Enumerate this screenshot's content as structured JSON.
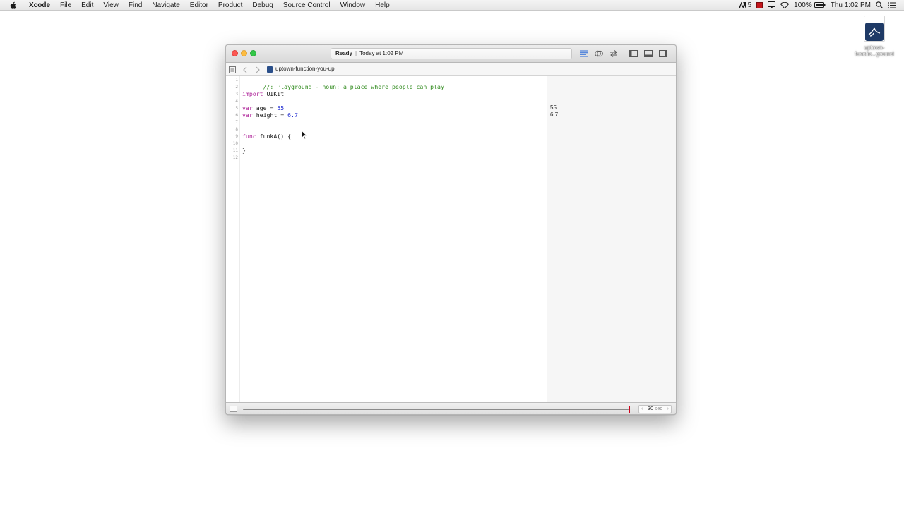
{
  "menubar": {
    "app_name": "Xcode",
    "items": [
      "File",
      "Edit",
      "View",
      "Find",
      "Navigate",
      "Editor",
      "Product",
      "Debug",
      "Source Control",
      "Window",
      "Help"
    ],
    "status": {
      "notifications_count": "5",
      "battery": "100%",
      "clock": "Thu 1:02 PM"
    }
  },
  "desktop": {
    "file_label": "uptown-functio...ground"
  },
  "window": {
    "activity_status": "Ready",
    "activity_separator": "|",
    "activity_time": "Today at 1:02 PM",
    "jumpbar_file": "uptown-function-you-up"
  },
  "editor": {
    "line_numbers": [
      "1",
      "2",
      "3",
      "4",
      "5",
      "6",
      "7",
      "8",
      "9",
      "10",
      "11",
      "12"
    ],
    "lines": {
      "l1_comment": "//: Playground - noun: a place where people can play",
      "l3_keyword": "import",
      "l3_rest": " UIKit",
      "l5_keyword": "var",
      "l5_rest": " age = ",
      "l5_number": "55",
      "l6_keyword": "var",
      "l6_rest": " height = ",
      "l6_number": "6.7",
      "l9_keyword": "func",
      "l9_rest": " funkA() {",
      "l11": "}"
    }
  },
  "results": {
    "age": "55",
    "height": "6.7"
  },
  "timeline": {
    "duration_value": "30",
    "duration_unit": "sec",
    "scrubber_position_fraction": 1.0
  },
  "colors": {
    "comment": "#2f8a1c",
    "keyword": "#b0279b",
    "number": "#1f2bd0",
    "scrubber": "#d0021b"
  }
}
